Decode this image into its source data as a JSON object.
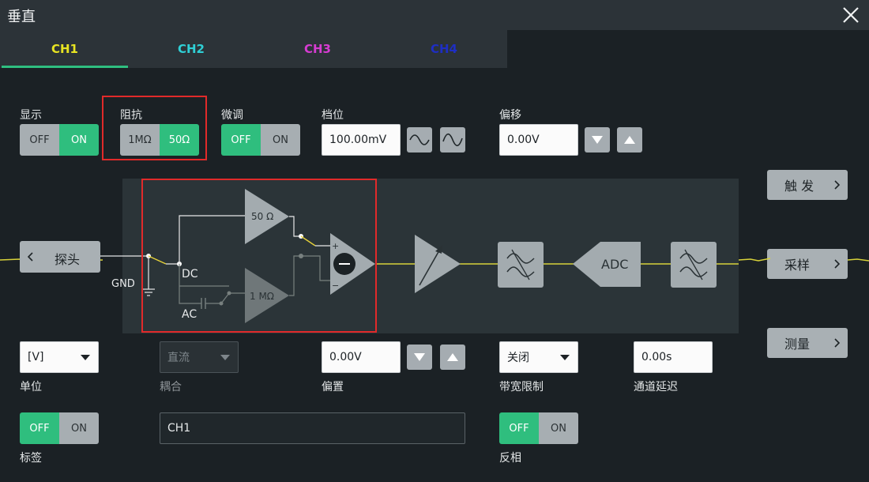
{
  "window": {
    "title": "垂直"
  },
  "tabs": [
    {
      "label": "CH1",
      "color": "#e8e422"
    },
    {
      "label": "CH2",
      "color": "#2fd0d6"
    },
    {
      "label": "CH3",
      "color": "#d63cd1"
    },
    {
      "label": "CH4",
      "color": "#1e2ec4"
    }
  ],
  "controls": {
    "display": {
      "label": "显示",
      "off": "OFF",
      "on": "ON",
      "selected": "ON"
    },
    "impedance": {
      "label": "阻抗",
      "opt1": "1MΩ",
      "opt2": "50Ω",
      "selected": "50Ω"
    },
    "fine": {
      "label": "微调",
      "off": "OFF",
      "on": "ON",
      "selected": "OFF"
    },
    "scale": {
      "label": "档位",
      "value": "100.00mV"
    },
    "offset": {
      "label": "偏移",
      "value": "0.00V"
    },
    "unit": {
      "label": "单位",
      "value": "[V]"
    },
    "coupling": {
      "label": "耦合",
      "value": "直流"
    },
    "bias": {
      "label": "偏置",
      "value": "0.00V"
    },
    "bandwidth": {
      "label": "带宽限制",
      "value": "关闭"
    },
    "delay": {
      "label": "通道延迟",
      "value": "0.00s"
    },
    "tag": {
      "label": "标签",
      "off": "OFF",
      "on": "ON",
      "selected": "OFF",
      "text": "CH1"
    },
    "invert": {
      "label": "反相",
      "off": "OFF",
      "on": "ON",
      "selected": "OFF"
    }
  },
  "side_buttons": {
    "trigger": "触 发",
    "sample": "采样",
    "measure": "测量"
  },
  "probe_button": "探头",
  "diagram": {
    "gnd": "GND",
    "dc": "DC",
    "ac": "AC",
    "amp_50": "50 Ω",
    "amp_1m": "1 MΩ",
    "plus": "+",
    "minus": "−",
    "adc": "ADC"
  },
  "colors": {
    "accent": "#2fbf80",
    "highlight": "#e12a2a",
    "trace": "#d8d23a"
  },
  "icons": [
    "close-icon",
    "chevron-left-icon",
    "chevron-right-icon",
    "sine-wave-icon",
    "triangle-down-icon",
    "triangle-up-icon",
    "filter-icon"
  ]
}
